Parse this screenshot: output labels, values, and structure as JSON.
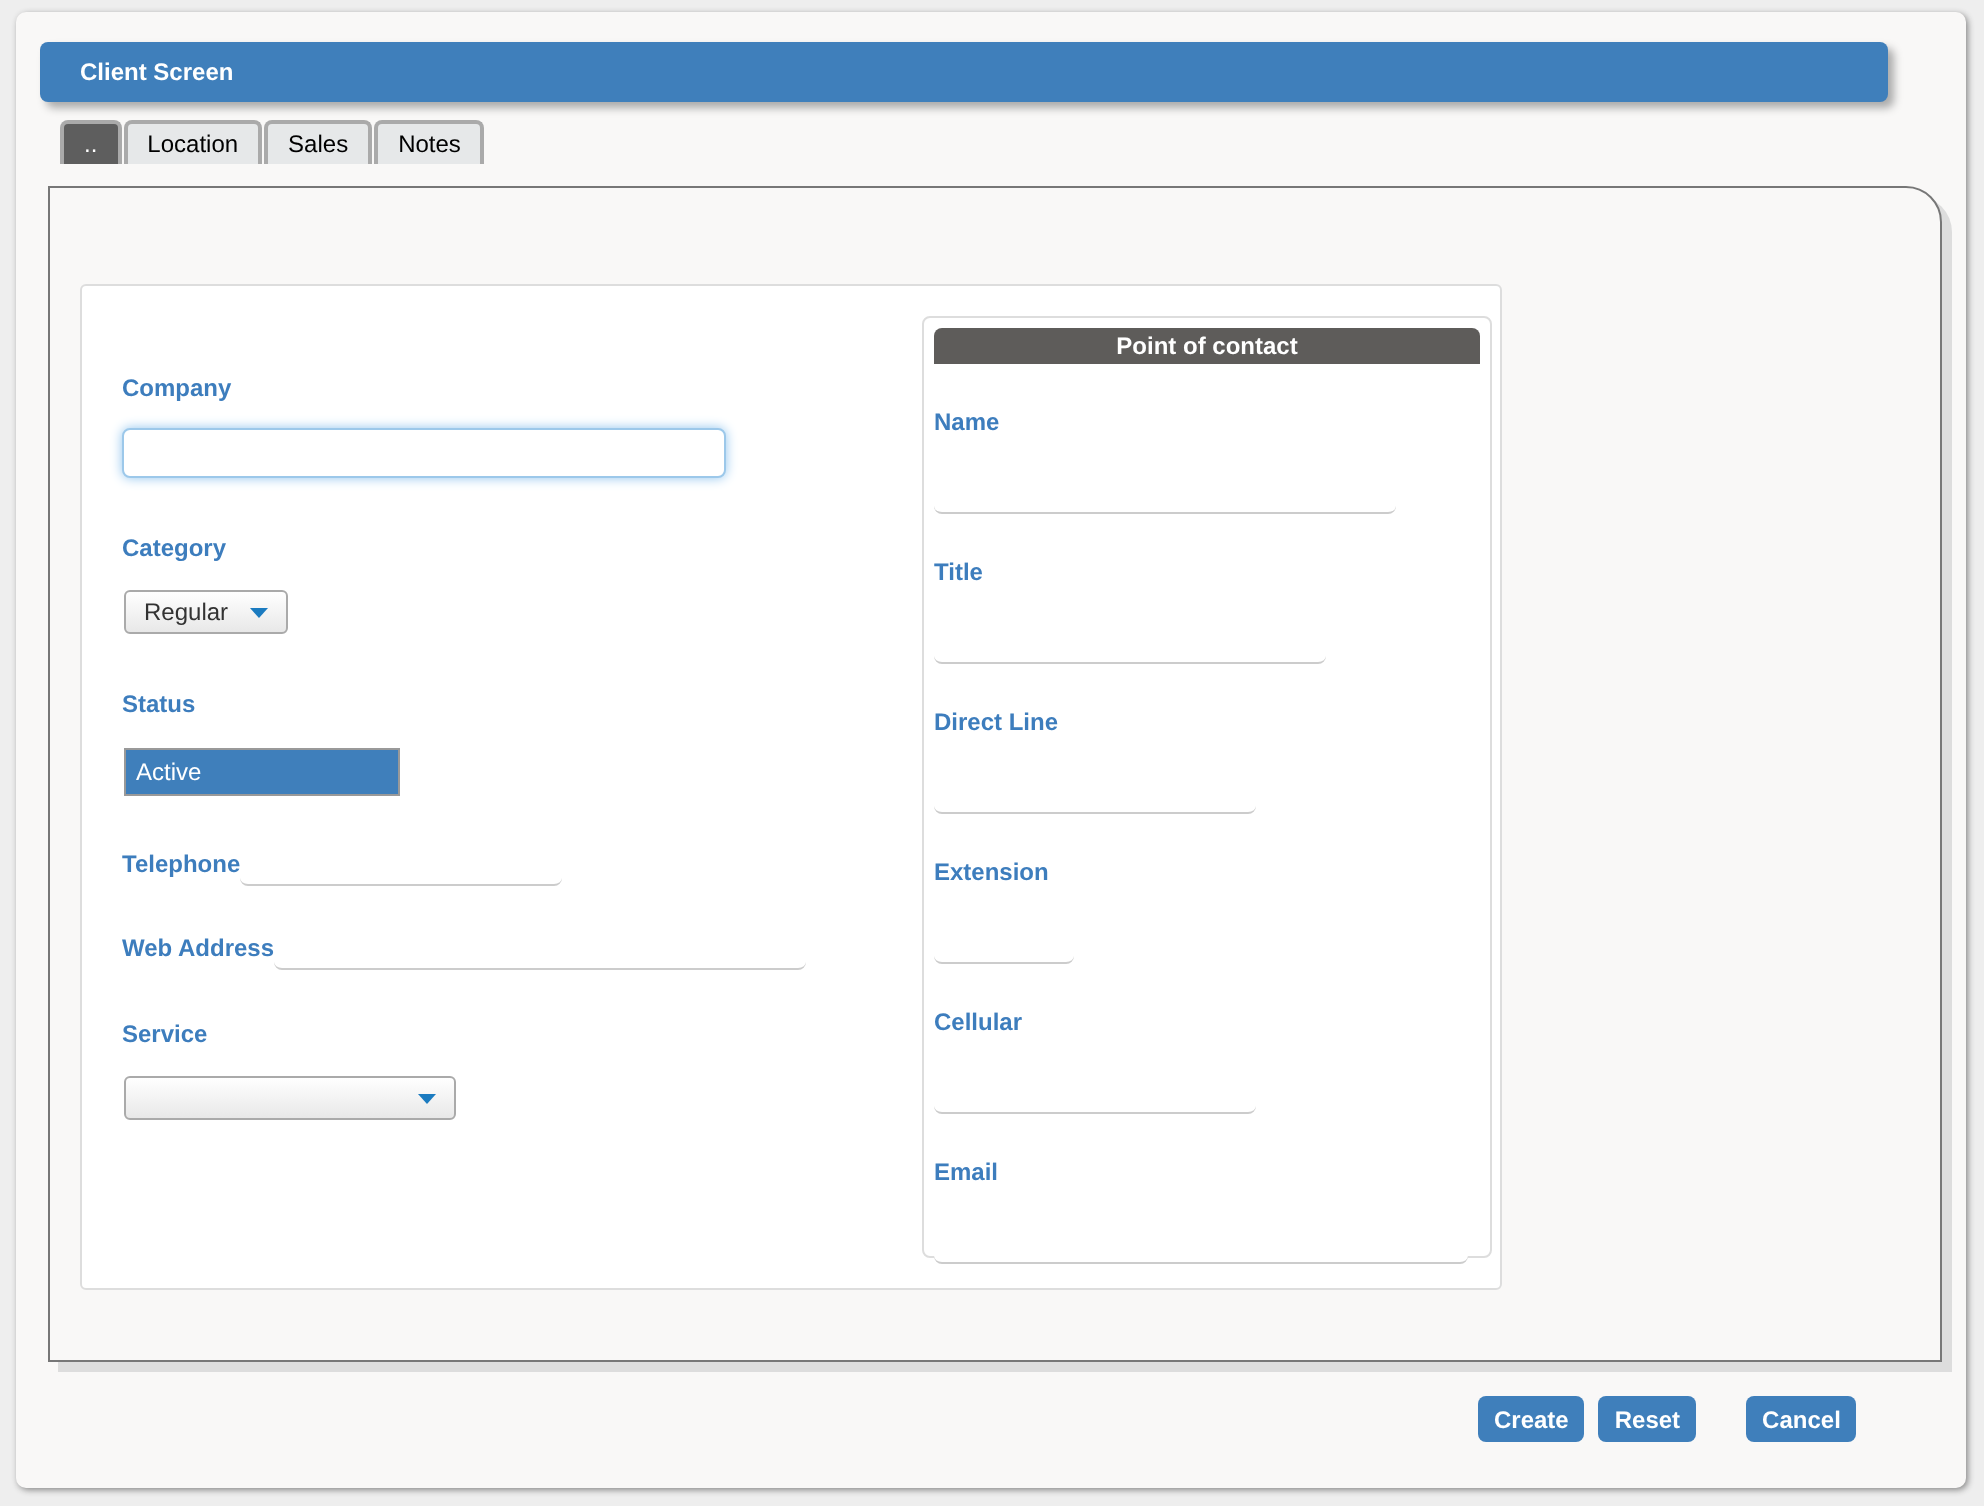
{
  "window": {
    "title": "Client Screen"
  },
  "tabs": [
    {
      "label": "..",
      "selected": true
    },
    {
      "label": "Location",
      "selected": false
    },
    {
      "label": "Sales",
      "selected": false
    },
    {
      "label": "Notes",
      "selected": false
    }
  ],
  "company_fields": [
    {
      "kind": "text",
      "label": "Company",
      "focused": true
    },
    {
      "kind": "select",
      "label": "Category",
      "value": "Regular"
    },
    {
      "kind": "listbox",
      "label": "Status",
      "value": "Active"
    },
    {
      "kind": "inline",
      "label": "Telephone"
    },
    {
      "kind": "inline",
      "label": "Web Address"
    },
    {
      "kind": "select",
      "label": "Service"
    }
  ],
  "contact": {
    "title": "Point of contact",
    "fields": [
      {
        "label": "Name"
      },
      {
        "label": "Title"
      },
      {
        "label": "Direct Line"
      },
      {
        "label": "Extension"
      },
      {
        "label": "Cellular"
      },
      {
        "label": "Email"
      }
    ]
  },
  "buttons": [
    "Create",
    "Reset",
    "Cancel"
  ]
}
